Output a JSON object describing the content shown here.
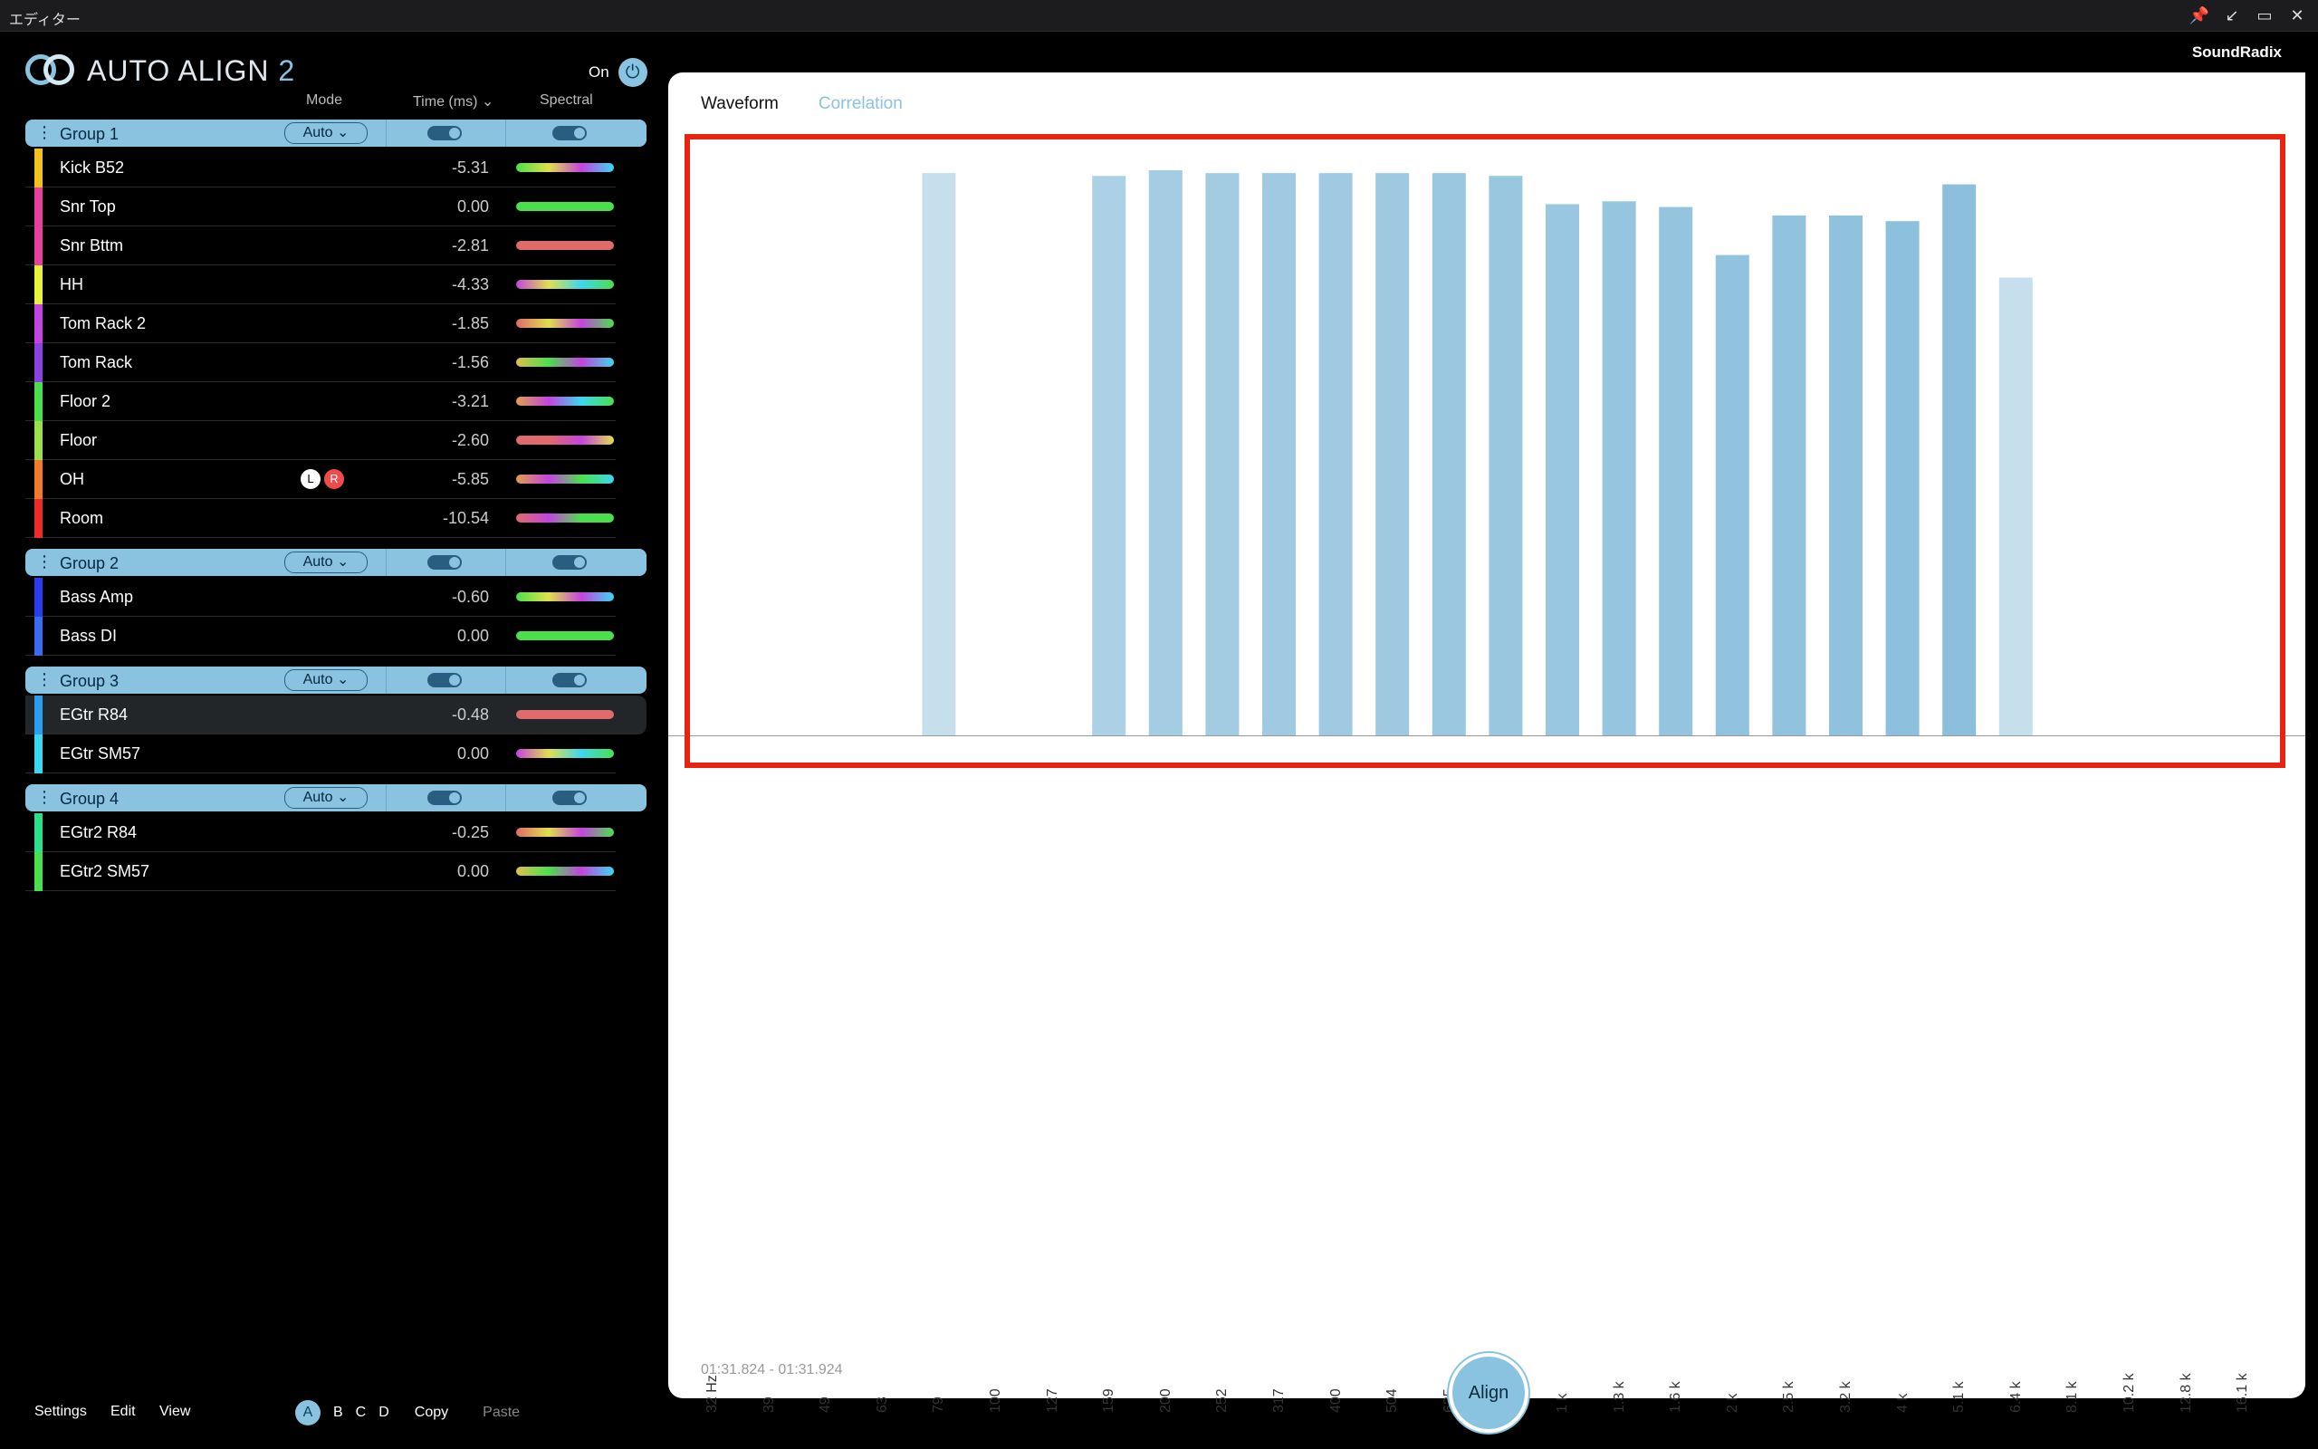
{
  "window": {
    "title": "エディター"
  },
  "plugin": {
    "logo": "AUTO ALIGN",
    "logo_num": "2",
    "on_label": "On",
    "brand": "SoundRadix"
  },
  "columns": {
    "mode": "Mode",
    "time": "Time (ms)",
    "spectral": "Spectral"
  },
  "groups": [
    {
      "name": "Group 1",
      "mode": "Auto",
      "tracks": [
        {
          "name": "Kick B52",
          "time": "-5.31",
          "color": "#f2c21b"
        },
        {
          "name": "Snr Top",
          "time": "0.00",
          "color": "#e83f9c"
        },
        {
          "name": "Snr Bttm",
          "time": "-2.81",
          "color": "#e83f9c"
        },
        {
          "name": "HH",
          "time": "-4.33",
          "color": "#e7f23a"
        },
        {
          "name": "Tom Rack 2",
          "time": "-1.85",
          "color": "#c543e0"
        },
        {
          "name": "Tom Rack",
          "time": "-1.56",
          "color": "#8a43e0"
        },
        {
          "name": "Floor 2",
          "time": "-3.21",
          "color": "#4be04b"
        },
        {
          "name": "Floor",
          "time": "-2.60",
          "color": "#9be04b"
        },
        {
          "name": "OH",
          "time": "-5.85",
          "color": "#f27a2a",
          "stereo": {
            "l": "L",
            "r": "R"
          }
        },
        {
          "name": "Room",
          "time": "-10.54",
          "color": "#ef2a2a"
        }
      ]
    },
    {
      "name": "Group 2",
      "mode": "Auto",
      "tracks": [
        {
          "name": "Bass Amp",
          "time": "-0.60",
          "color": "#2a3ef0"
        },
        {
          "name": "Bass DI",
          "time": "0.00",
          "color": "#3a6cf0"
        }
      ]
    },
    {
      "name": "Group 3",
      "mode": "Auto",
      "tracks": [
        {
          "name": "EGtr R84",
          "time": "-0.48",
          "color": "#2a9ef0"
        },
        {
          "name": "EGtr SM57",
          "time": "0.00",
          "color": "#3ad8f0"
        }
      ]
    },
    {
      "name": "Group 4",
      "mode": "Auto",
      "tracks": [
        {
          "name": "EGtr2 R84",
          "time": "-0.25",
          "color": "#2ae08a"
        },
        {
          "name": "EGtr2 SM57",
          "time": "0.00",
          "color": "#4be04b"
        }
      ]
    }
  ],
  "footer": {
    "settings": "Settings",
    "edit": "Edit",
    "view": "View",
    "a": "A",
    "b": "B",
    "c": "C",
    "d": "D",
    "copy": "Copy",
    "paste": "Paste"
  },
  "tabs": {
    "waveform": "Waveform",
    "correlation": "Correlation"
  },
  "range_text": "01:31.824 - 01:31.924",
  "align_label": "Align",
  "colors": {
    "accent": "#8ac3df",
    "highlight": "#e8230f"
  },
  "chart_data": {
    "type": "bar",
    "categories": [
      "32 Hz",
      "39",
      "49",
      "63",
      "79",
      "100",
      "127",
      "159",
      "200",
      "252",
      "317",
      "400",
      "504",
      "635",
      "800",
      "1 k",
      "1.3 k",
      "1.6 k",
      "2 k",
      "2.5 k",
      "3.2 k",
      "4 k",
      "5.1 k",
      "6.4 k",
      "8.1 k",
      "10.2 k",
      "12.8 k",
      "16.1 k"
    ],
    "values": [
      0,
      0,
      0,
      0,
      0.995,
      0,
      0,
      0.99,
      1.0,
      0.995,
      0.995,
      0.995,
      0.995,
      0.995,
      0.99,
      0.94,
      0.945,
      0.935,
      0.85,
      0.92,
      0.92,
      0.91,
      0.975,
      0.81,
      0,
      0,
      0,
      0
    ],
    "ylim": [
      0,
      1
    ]
  }
}
